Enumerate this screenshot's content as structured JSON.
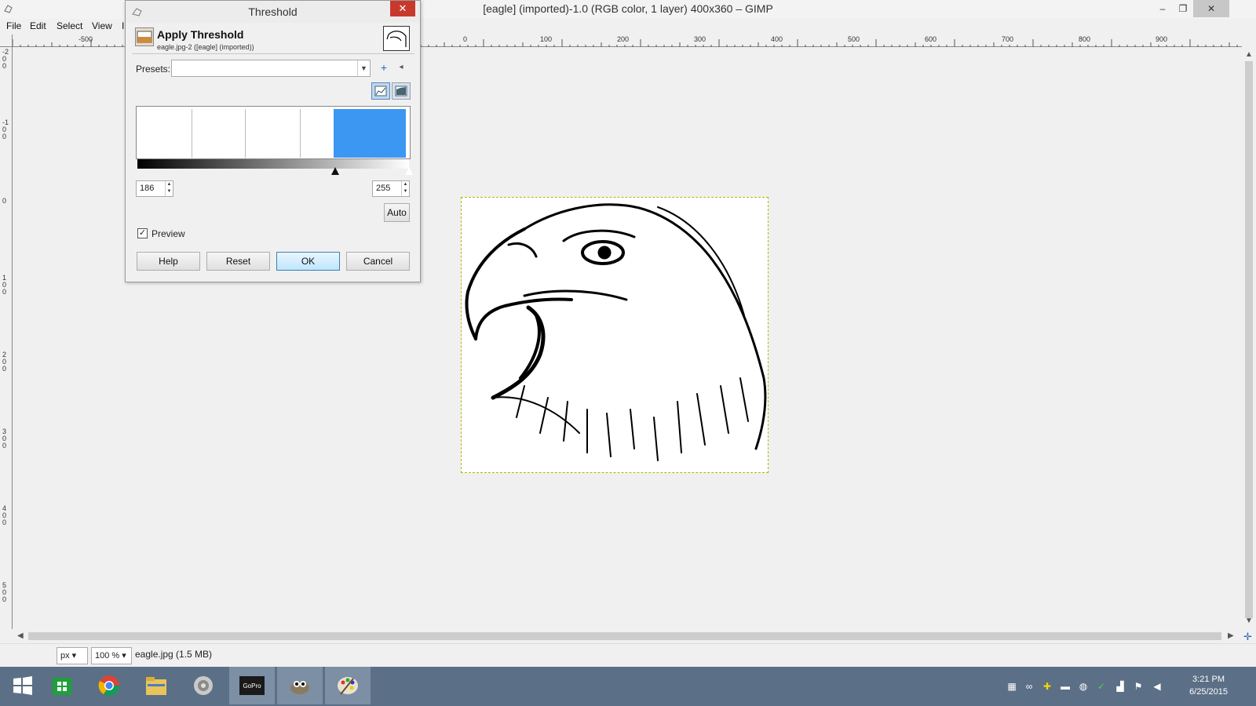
{
  "window": {
    "title": "[eagle] (imported)-1.0 (RGB color, 1 layer) 400x360 – GIMP",
    "minimize": "–",
    "restore": "❐",
    "close": "✕"
  },
  "menu": [
    "File",
    "Edit",
    "Select",
    "View",
    "I"
  ],
  "ruler": {
    "h_labels": [
      "-500",
      "0",
      "100",
      "200",
      "300",
      "400",
      "500",
      "600",
      "700",
      "800",
      "900"
    ],
    "v_labels": [
      "-200",
      "-100",
      "0",
      "100",
      "200",
      "300",
      "400",
      "500"
    ]
  },
  "dialog": {
    "title": "Threshold",
    "close": "✕",
    "header_title": "Apply Threshold",
    "header_subtitle": "eagle.jpg-2 ([eagle] (imported))",
    "presets_label": "Presets:",
    "presets_value": "",
    "add_icon": "+",
    "menu_icon": "◂",
    "low_value": "186",
    "high_value": "255",
    "auto_label": "Auto",
    "preview_label": "Preview",
    "preview_checked": true,
    "buttons": {
      "help": "Help",
      "reset": "Reset",
      "ok": "OK",
      "cancel": "Cancel"
    },
    "threshold_range": [
      186,
      255
    ],
    "selection_color": "#3c97f3"
  },
  "status": {
    "unit": "px",
    "zoom": "100 %",
    "file_info": "eagle.jpg (1.5 MB)"
  },
  "taskbar": {
    "clock_time": "3:21 PM",
    "clock_date": "6/25/2015",
    "apps": [
      "windows-start",
      "store",
      "chrome",
      "file-explorer",
      "media",
      "gopro",
      "gimp",
      "paint"
    ]
  }
}
